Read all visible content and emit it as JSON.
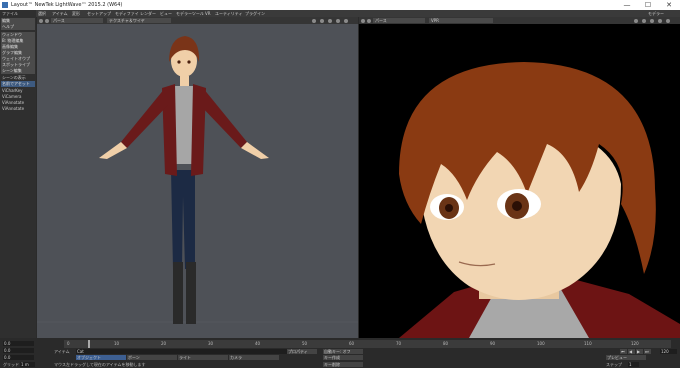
{
  "window": {
    "title": "Layout™ NewTek LightWave™ 2015.2 (W64)",
    "minimize": "—",
    "maximize": "☐",
    "close": "✕"
  },
  "menubar": {
    "items": [
      "ファイル",
      "編集",
      "ヘルプ",
      "選択",
      "アイテム",
      "変形",
      "セットアップ",
      "モディファイ",
      "レンダー",
      "ビュー",
      "モデラーツール",
      "VR",
      "ユーティリティ",
      "プラグイン"
    ],
    "right_label": "モデラー"
  },
  "left_viewport": {
    "view_select": "パース",
    "shading_select": "テクスチャ＆ワイヤ"
  },
  "right_viewport": {
    "view_select": "パース",
    "renderer_select": "VPR"
  },
  "sidebar": {
    "items": [
      {
        "label": "ファイル",
        "style": "plain"
      },
      {
        "label": "編集",
        "style": "gray"
      },
      {
        "label": "ヘルプ",
        "style": "gray"
      },
      {
        "label": "ウィンドウ",
        "style": "gray"
      },
      {
        "label": "B: 物理編集",
        "style": "gray"
      },
      {
        "label": "画像編集",
        "style": "gray"
      },
      {
        "label": "グラフ編集",
        "style": "gray"
      },
      {
        "label": "ウェイトオウプ",
        "style": "gray"
      },
      {
        "label": "スポットライブ",
        "style": "gray"
      },
      {
        "label": "シーン編集",
        "style": "gray"
      },
      {
        "label": "シーンの表示",
        "style": "plain"
      },
      {
        "label": "名前でアセット",
        "style": "blue"
      },
      {
        "label": "ViCharKey",
        "style": "plain"
      },
      {
        "label": "ViCamera",
        "style": "plain"
      },
      {
        "label": "ViAnnotate",
        "style": "plain"
      },
      {
        "label": "ViAnnotate",
        "style": "plain"
      }
    ]
  },
  "timeline": {
    "ticks": [
      "0",
      "10",
      "20",
      "30",
      "40",
      "50",
      "60",
      "70",
      "80",
      "90",
      "100",
      "110",
      "120"
    ],
    "position_value": "0.0",
    "position_x": "0.0",
    "position_y": "0.0",
    "grid_label": "グリッド",
    "grid_value": "1 m",
    "item_label": "アイテム",
    "item_value": "Cat",
    "objects_button": "オブジェクト",
    "bones_button": "ボーン",
    "lights_button": "ライト",
    "cameras_button": "カメラ",
    "properties_button": "プロパティ",
    "auto_key_button": "自動キー: オフ",
    "create_key_button": "キー作成",
    "delete_key_button": "キー削除",
    "status_message": "マウス左ドラッグして現在のアイテムを移動します",
    "preview_button": "プレビュー",
    "step_label": "ステップ",
    "step_value": "1",
    "end_value": "120"
  }
}
